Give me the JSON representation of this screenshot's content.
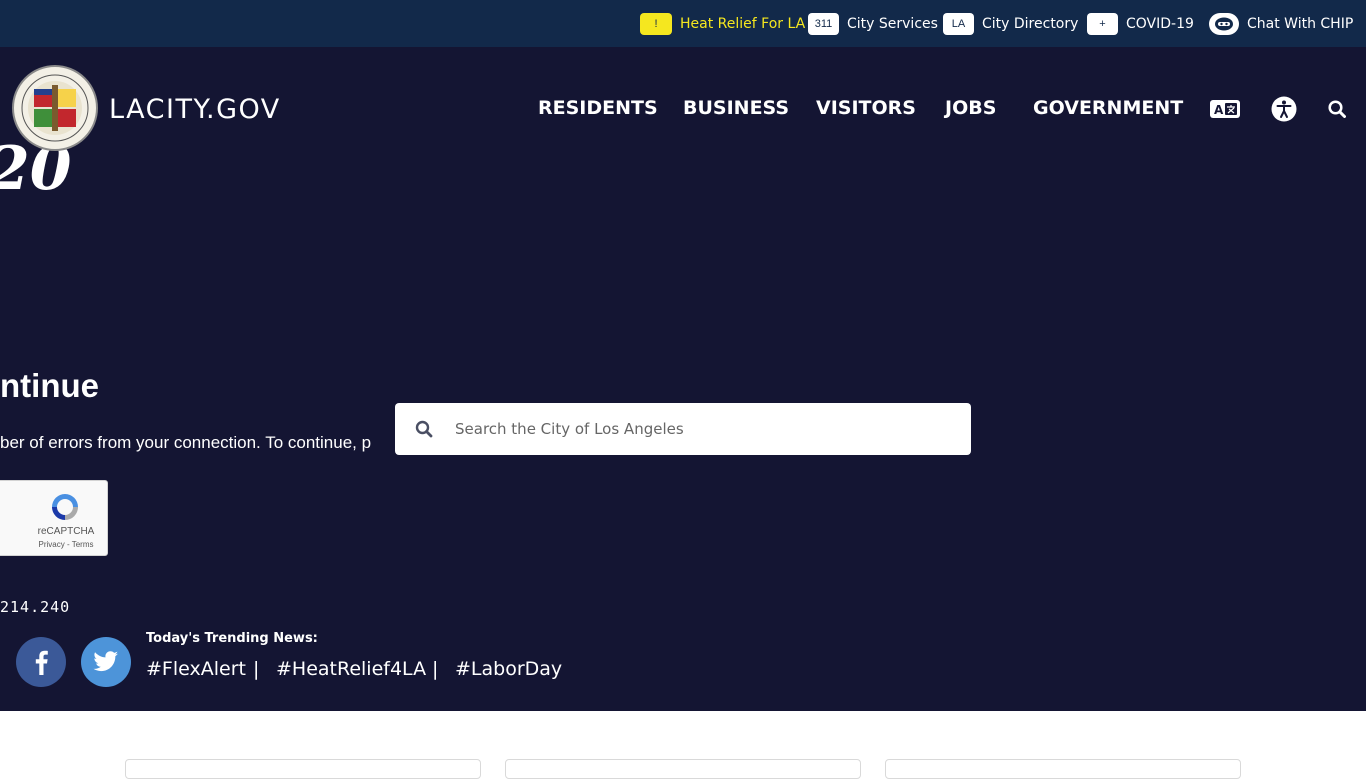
{
  "utility_bar": {
    "items": [
      {
        "badge": "!",
        "label": "Heat Relief For LA"
      },
      {
        "badge": "311",
        "label": "City Services"
      },
      {
        "badge": "LA",
        "label": "City Directory"
      },
      {
        "badge": "+",
        "label": "COVID-19"
      },
      {
        "badge": "",
        "label": "Chat With CHIP"
      }
    ],
    "highlight_color": "#f5e71f"
  },
  "header": {
    "logo_text": "LACITY.GOV",
    "nav": [
      "RESIDENTS",
      "BUSINESS",
      "VISITORS",
      "JOBS",
      "GOVERNMENT"
    ],
    "icons": [
      "translate-icon",
      "accessibility-icon",
      "search-icon"
    ]
  },
  "background_page": {
    "logo_fragment": "20",
    "title_fragment": "ntinue",
    "message_fragment": "ber of errors from your connection. To continue, p",
    "captcha": {
      "label": "reCAPTCHA",
      "links": "Privacy - Terms"
    },
    "ip_fragment": "214.240"
  },
  "search": {
    "placeholder": "Search the City of Los Angeles"
  },
  "social": [
    "facebook-icon",
    "twitter-icon"
  ],
  "trending": {
    "label": "Today's Trending News:",
    "tags": [
      "#FlexAlert",
      "#HeatRelief4LA",
      "#LaborDay"
    ],
    "separator": "|"
  },
  "colors": {
    "top_bar": "#12294a",
    "hero": "#141533",
    "facebook": "#3b5998",
    "twitter": "#4d94d9"
  }
}
